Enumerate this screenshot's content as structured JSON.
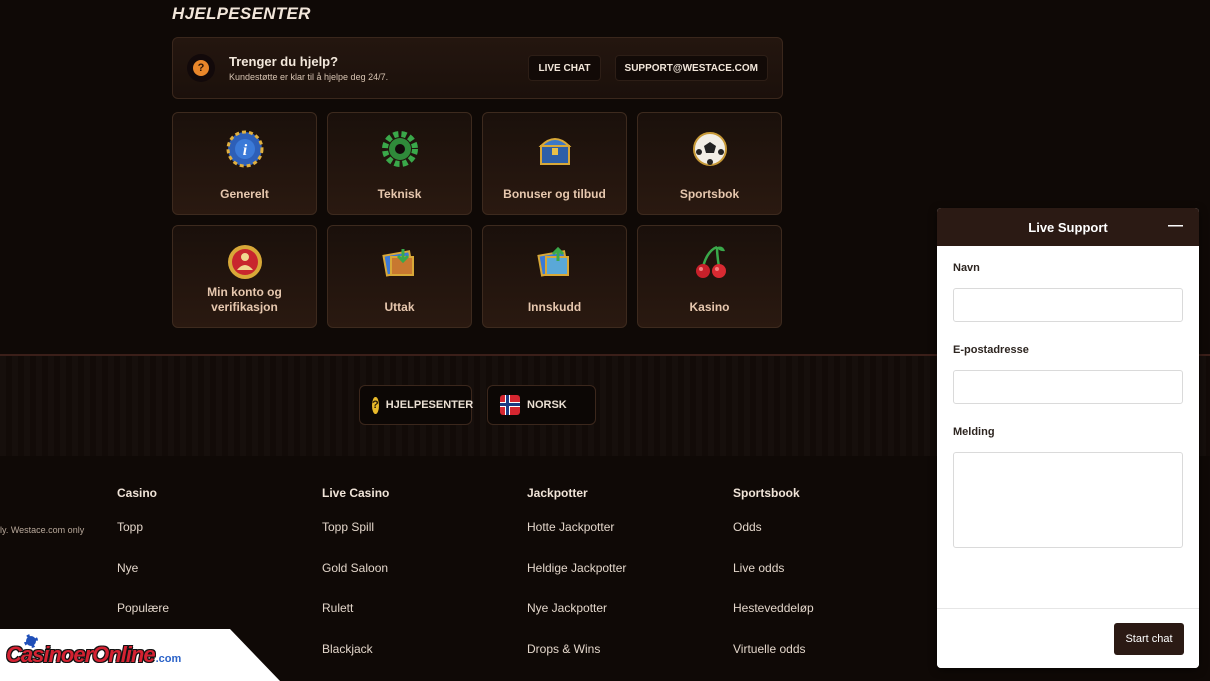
{
  "page": {
    "title": "HJELPESENTER"
  },
  "banner": {
    "title": "Trenger du hjelp?",
    "subtitle": "Kundestøtte er klar til å hjelpe deg 24/7.",
    "live_chat_label": "LIVE CHAT",
    "email_label": "SUPPORT@WESTACE.COM",
    "icon_glyph": "?"
  },
  "categories": [
    {
      "label": "Generelt",
      "icon": "info-chip-icon"
    },
    {
      "label": "Teknisk",
      "icon": "gear-icon"
    },
    {
      "label": "Bonuser og tilbud",
      "icon": "treasure-chest-icon"
    },
    {
      "label": "Sportsbok",
      "icon": "soccer-ball-icon"
    },
    {
      "label": "Min konto og verifikasjon",
      "icon": "account-badge-icon"
    },
    {
      "label": "Uttak",
      "icon": "withdraw-map-icon"
    },
    {
      "label": "Innskudd",
      "icon": "deposit-map-icon"
    },
    {
      "label": "Kasino",
      "icon": "cherries-icon"
    }
  ],
  "pills": {
    "help_label": "HJELPESENTER",
    "lang_label": "NORSK",
    "help_glyph": "?"
  },
  "footer": {
    "note": "ly. Westace.com only",
    "columns": [
      {
        "heading": "Casino",
        "links": [
          "Topp",
          "Nye",
          "Populære"
        ]
      },
      {
        "heading": "Live Casino",
        "links": [
          "Topp Spill",
          "Gold Saloon",
          "Rulett",
          "Blackjack"
        ]
      },
      {
        "heading": "Jackpotter",
        "links": [
          "Hotte Jackpotter",
          "Heldige Jackpotter",
          "Nye Jackpotter",
          "Drops & Wins"
        ]
      },
      {
        "heading": "Sportsbook",
        "links": [
          "Odds",
          "Live odds",
          "Hesteveddeløp",
          "Virtuelle odds"
        ]
      }
    ]
  },
  "logo": {
    "text": "CasinoerOnline",
    "suffix": ".com"
  },
  "chat": {
    "title": "Live Support",
    "minimize_glyph": "—",
    "name_label": "Navn",
    "email_label": "E-postadresse",
    "message_label": "Melding",
    "start_label": "Start chat"
  },
  "colors": {
    "accent": "#e8862a",
    "brand_dark": "#2b1a14",
    "label_gold": "#e6c7ae"
  }
}
